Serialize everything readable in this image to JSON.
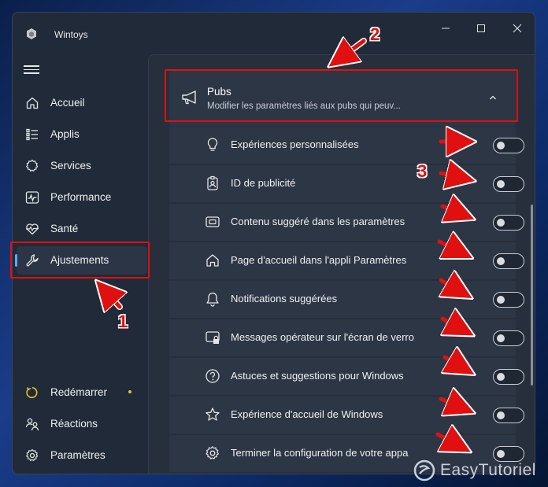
{
  "window": {
    "title": "Wintoys",
    "controls": [
      "minimize",
      "maximize",
      "close"
    ]
  },
  "sidebar": {
    "items": [
      {
        "label": "Accueil",
        "icon": "home-icon"
      },
      {
        "label": "Applis",
        "icon": "apps-list-icon"
      },
      {
        "label": "Services",
        "icon": "gear-services-icon"
      },
      {
        "label": "Performance",
        "icon": "pulse-icon"
      },
      {
        "label": "Santé",
        "icon": "heart-pulse-icon"
      },
      {
        "label": "Ajustements",
        "icon": "wrench-icon",
        "active": true
      }
    ],
    "footer": [
      {
        "label": "Redémarrer",
        "icon": "restart-icon",
        "badge_color": "#e7c12b"
      },
      {
        "label": "Réactions",
        "icon": "people-icon"
      },
      {
        "label": "Paramètres",
        "icon": "settings-icon"
      }
    ]
  },
  "section": {
    "title": "Pubs",
    "subtitle": "Modifier les paramètres liés aux pubs qui peuv...",
    "icon": "megaphone-icon",
    "expanded": true
  },
  "settings": [
    {
      "label": "Expériences personnalisées",
      "icon": "lightbulb-icon",
      "on": false
    },
    {
      "label": "ID de publicité",
      "icon": "id-badge-icon",
      "on": false
    },
    {
      "label": "Contenu suggéré dans les paramètres",
      "icon": "card-icon",
      "on": false
    },
    {
      "label": "Page d'accueil dans l'appli Paramètres",
      "icon": "home-icon",
      "on": false
    },
    {
      "label": "Notifications suggérées",
      "icon": "bell-icon",
      "on": false
    },
    {
      "label": "Messages opérateur sur l'écran de verro",
      "icon": "lock-screen-icon",
      "on": false
    },
    {
      "label": "Astuces et suggestions pour Windows",
      "icon": "help-circle-icon",
      "on": false
    },
    {
      "label": "Expérience d'accueil de Windows",
      "icon": "star-icon",
      "on": false
    },
    {
      "label": "Terminer la configuration de votre appa",
      "icon": "gear-icon",
      "on": false
    }
  ],
  "annotations": {
    "num1": "1",
    "num2": "2",
    "num3": "3",
    "color": "#e01010"
  },
  "watermark": {
    "text": "EasyTutoriel"
  }
}
